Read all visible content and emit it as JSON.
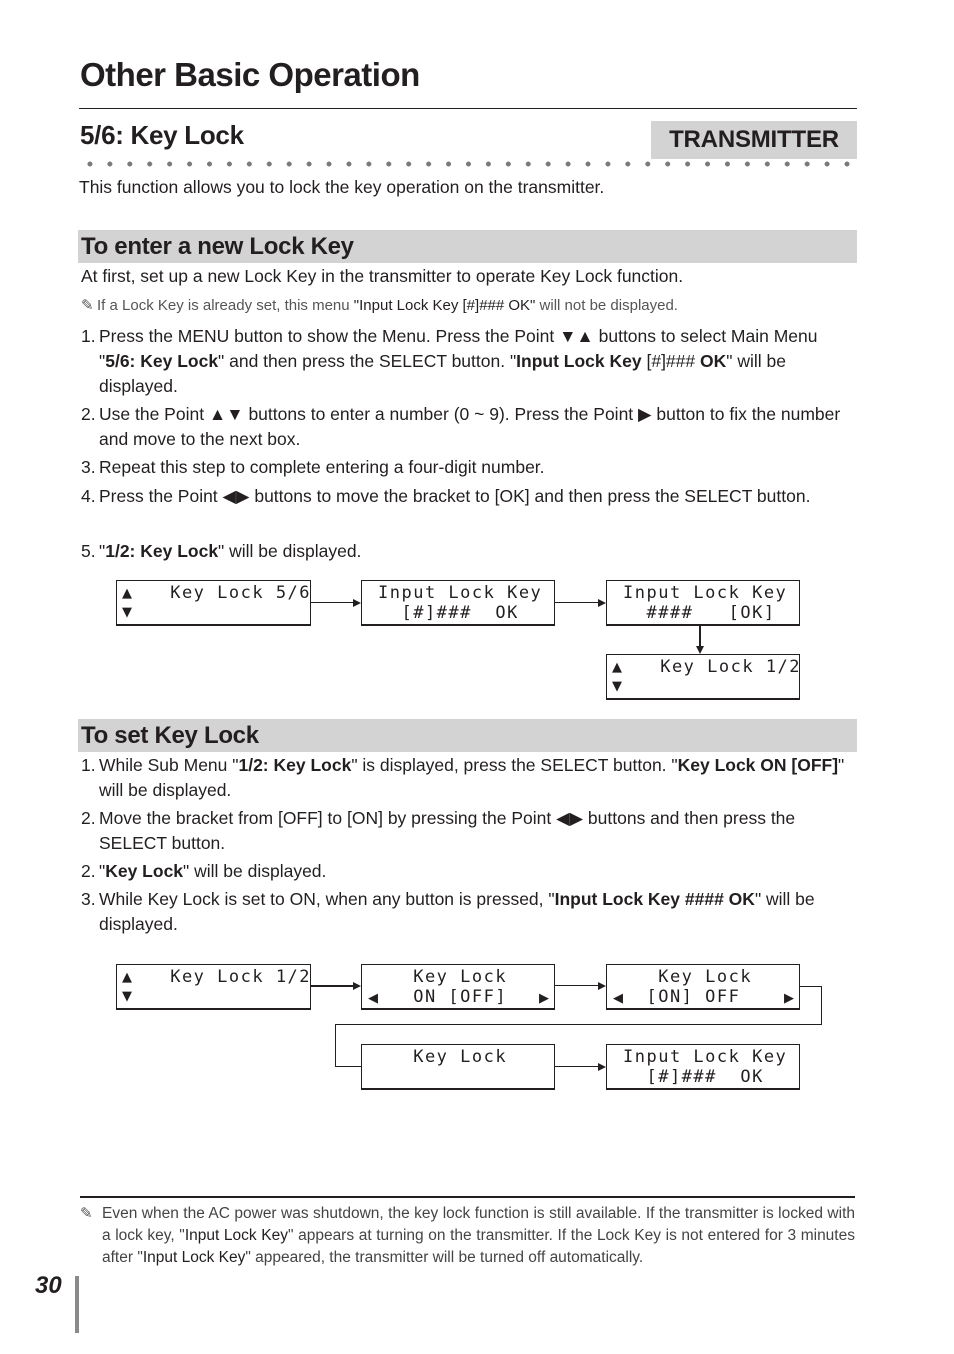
{
  "page": {
    "title": "Other Basic Operation",
    "section_title": "5/6: Key Lock",
    "badge": "TRANSMITTER",
    "intro": "This function allows you to lock the key operation on the transmitter.",
    "page_number": "30"
  },
  "enter_section": {
    "heading": "To enter a new Lock Key",
    "lead": "At first, set up a new Lock Key in the transmitter to operate Key Lock function.",
    "note": {
      "icon": "pencil-icon",
      "pre": "If a Lock Key is already set, this menu ",
      "bold": "\"Input Lock Key [#]### OK\"",
      "post": " will not be displayed."
    },
    "steps": [
      {
        "num": "1.",
        "parts": [
          {
            "t": "Press the MENU button to show the Menu. Press the Point "
          },
          {
            "t": "▼▲",
            "icon": "down-up-triangle-icon"
          },
          {
            "t": " buttons to select Main Menu \""
          },
          {
            "t": "5/6: Key Lock",
            "b": true
          },
          {
            "t": "\"  and then press the SELECT button. \""
          },
          {
            "t": "Input Lock Key",
            "b": true
          },
          {
            "t": " [#]### "
          },
          {
            "t": "OK",
            "b": true
          },
          {
            "t": "\" will be displayed."
          }
        ]
      },
      {
        "num": "2.",
        "parts": [
          {
            "t": "Use the Point "
          },
          {
            "t": "▲▼",
            "icon": "up-down-triangle-icon"
          },
          {
            "t": " buttons to enter a number (0 ~ 9). Press the Point "
          },
          {
            "t": "▶",
            "icon": "right-triangle-icon"
          },
          {
            "t": " button to fix the number and move to the next box."
          }
        ]
      },
      {
        "num": "3.",
        "parts": [
          {
            "t": "Repeat this step to complete entering a four-digit number."
          }
        ]
      },
      {
        "num": "4.",
        "parts": [
          {
            "t": "Press the Point "
          },
          {
            "t": "◀▶",
            "icon": "left-right-triangle-icon"
          },
          {
            "t": " buttons to move the bracket to [OK] and then press the SELECT button."
          }
        ]
      },
      {
        "num": "5.",
        "parts": [
          {
            "t": "\""
          },
          {
            "t": "1/2: Key Lock",
            "b": true
          },
          {
            "t": "\" will be displayed."
          }
        ]
      }
    ],
    "diagram": {
      "screens": [
        {
          "id": "key-lock-5-6",
          "line1": "   Key Lock 5/6",
          "line2": "",
          "updown": true
        },
        {
          "id": "input-lock-key-1",
          "line1": "Input Lock Key",
          "line2": "  [#]###  OK",
          "updown": false
        },
        {
          "id": "input-lock-key-ok",
          "line1": "Input Lock Key",
          "line2": "  ####   [OK]",
          "updown": false
        },
        {
          "id": "key-lock-1-2",
          "line1": "   Key Lock 1/2",
          "line2": "",
          "updown": true
        }
      ]
    }
  },
  "set_section": {
    "heading": "To set Key Lock",
    "steps": [
      {
        "num": "1.",
        "parts": [
          {
            "t": "While Sub Menu \""
          },
          {
            "t": "1/2: Key Lock",
            "b": true
          },
          {
            "t": "\" is displayed, press the SELECT button. \""
          },
          {
            "t": "Key Lock ON [OFF]",
            "b": true
          },
          {
            "t": "\" will be displayed."
          }
        ]
      },
      {
        "num": "2.",
        "parts": [
          {
            "t": "Move the bracket from [OFF] to [ON] by pressing the Point "
          },
          {
            "t": "◀▶",
            "icon": "left-right-triangle-icon"
          },
          {
            "t": " buttons and then press the SELECT button."
          }
        ]
      },
      {
        "num": "2.",
        "parts": [
          {
            "t": "\""
          },
          {
            "t": "Key Lock",
            "b": true
          },
          {
            "t": "\" will be displayed."
          }
        ]
      },
      {
        "num": "3.",
        "parts": [
          {
            "t": " While Key Lock is set to ON, when any button is pressed, \""
          },
          {
            "t": "Input Lock Key #### OK",
            "b": true
          },
          {
            "t": "\" will be displayed."
          }
        ]
      }
    ],
    "diagram": {
      "screens": [
        {
          "id": "key-lock-1-2",
          "line1": "   Key Lock 1/2",
          "line2": "",
          "updown": true
        },
        {
          "id": "key-lock-off",
          "line1": "   Key Lock",
          "line2": "   ON [OFF]",
          "leftright": true
        },
        {
          "id": "key-lock-on",
          "line1": "   Key Lock",
          "line2": "  [ON] OFF",
          "leftright": true
        },
        {
          "id": "key-lock",
          "line1": "   Key Lock",
          "line2": ""
        },
        {
          "id": "input-lock-key-2",
          "line1": "Input Lock Key",
          "line2": "  [#]###  OK"
        }
      ]
    }
  },
  "footnote": {
    "icon": "pencil-icon",
    "parts": [
      {
        "t": "Even when the AC power was shutdown, the key lock function is still available. If the transmitter is locked with a lock key, \""
      },
      {
        "t": "Input Lock Key",
        "b": true
      },
      {
        "t": "\" appears at turning on the transmitter. If the Lock Key is not entered for 3 minutes after \""
      },
      {
        "t": "Input Lock Key",
        "b": true
      },
      {
        "t": "\" appeared, the transmitter will be turned off automatically."
      }
    ]
  }
}
